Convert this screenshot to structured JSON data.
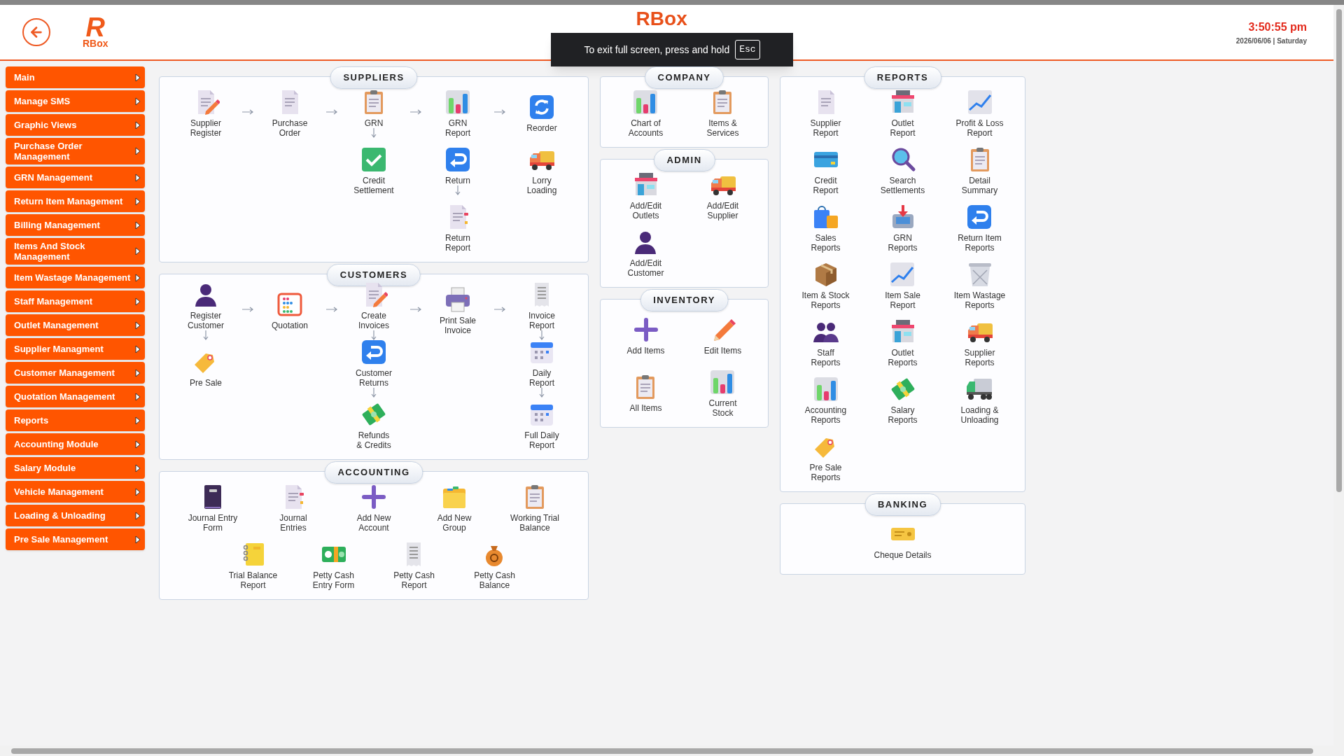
{
  "header": {
    "logo_letter": "R",
    "logo_name": "RBox",
    "title": "RBox",
    "time": "3:50:55 pm",
    "date": "2026/06/06 | Saturday"
  },
  "fullscreen_notice": {
    "text": "To exit full screen, press and hold",
    "key": "Esc"
  },
  "sidebar": {
    "items": [
      {
        "label": "Main"
      },
      {
        "label": "Manage SMS"
      },
      {
        "label": "Graphic Views"
      },
      {
        "label": "Purchase Order Management"
      },
      {
        "label": "GRN Management"
      },
      {
        "label": "Return Item Management"
      },
      {
        "label": "Billing Management"
      },
      {
        "label": "Items And Stock Management"
      },
      {
        "label": "Item Wastage Management"
      },
      {
        "label": "Staff Management"
      },
      {
        "label": "Outlet Management"
      },
      {
        "label": "Supplier Managment"
      },
      {
        "label": "Customer Management"
      },
      {
        "label": "Quotation Management"
      },
      {
        "label": "Reports"
      },
      {
        "label": "Accounting Module"
      },
      {
        "label": "Salary Module"
      },
      {
        "label": "Vehicle Management"
      },
      {
        "label": "Loading & Unloading"
      },
      {
        "label": "Pre Sale Management"
      }
    ]
  },
  "panel_columns": [
    {
      "sections": [
        {
          "title": "SUPPLIERS",
          "kind": "flow",
          "columns": [
            [
              {
                "label": "Supplier\nRegister",
                "flows_down": false
              }
            ],
            [
              {
                "label": "Purchase\nOrder",
                "flows_down": false
              }
            ],
            [
              {
                "label": "GRN",
                "flows_down": true
              },
              {
                "label": "Credit\nSettlement",
                "flows_down": false
              }
            ],
            [
              {
                "label": "GRN\nReport",
                "flows_down": false
              },
              {
                "label": "Return",
                "flows_down": true
              },
              {
                "label": "Return\nReport",
                "flows_down": false
              }
            ],
            [
              {
                "label": "Reorder",
                "flows_down": false
              },
              {
                "label": "Lorry\nLoading",
                "flows_down": false
              }
            ]
          ]
        },
        {
          "title": "CUSTOMERS",
          "kind": "flow",
          "columns": [
            [
              {
                "label": "Register\nCustomer",
                "flows_down": true
              },
              {
                "label": "Pre Sale",
                "flows_down": false
              }
            ],
            [
              {
                "label": "Quotation",
                "flows_down": false
              }
            ],
            [
              {
                "label": "Create\nInvoices",
                "flows_down": true
              },
              {
                "label": "Customer\nReturns",
                "flows_down": true
              },
              {
                "label": "Refunds\n& Credits",
                "flows_down": false
              }
            ],
            [
              {
                "label": "Print Sale\nInvoice",
                "flows_down": false
              }
            ],
            [
              {
                "label": "Invoice\nReport",
                "flows_down": true
              },
              {
                "label": "Daily\nReport",
                "flows_down": true
              },
              {
                "label": "Full Daily\nReport",
                "flows_down": false
              }
            ]
          ]
        },
        {
          "title": "ACCOUNTING",
          "kind": "centered_rows",
          "rows": [
            [
              {
                "label": "Journal Entry\nForm"
              },
              {
                "label": "Journal\nEntries"
              },
              {
                "label": "Add New\nAccount"
              },
              {
                "label": "Add New\nGroup"
              },
              {
                "label": "Working Trial\nBalance"
              }
            ],
            [
              {
                "label": "Trial Balance\nReport"
              },
              {
                "label": "Petty Cash\nEntry Form"
              },
              {
                "label": "Petty Cash\nReport"
              },
              {
                "label": "Petty Cash\nBalance"
              }
            ]
          ]
        }
      ]
    },
    {
      "sections": [
        {
          "title": "COMPANY",
          "kind": "grid",
          "rows": [
            [
              {
                "label": "Chart of\nAccounts"
              },
              {
                "label": "Items &\nServices"
              }
            ]
          ]
        },
        {
          "title": "ADMIN",
          "kind": "grid",
          "rows": [
            [
              {
                "label": "Add/Edit\nOutlets"
              },
              {
                "label": "Add/Edit\nSupplier"
              }
            ],
            [
              {
                "label": "Add/Edit\nCustomer"
              }
            ]
          ]
        },
        {
          "title": "INVENTORY",
          "kind": "grid",
          "rows": [
            [
              {
                "label": "Add Items"
              },
              {
                "label": "Edit Items"
              }
            ],
            [
              {
                "label": "All Items"
              },
              {
                "label": "Current\nStock"
              }
            ]
          ]
        }
      ]
    },
    {
      "sections": [
        {
          "title": "REPORTS",
          "kind": "grid",
          "rows": [
            [
              {
                "label": "Supplier\nReport"
              },
              {
                "label": "Outlet\nReport"
              },
              {
                "label": "Profit & Loss\nReport"
              }
            ],
            [
              {
                "label": "Credit\nReport"
              },
              {
                "label": "Search\nSettlements"
              },
              {
                "label": "Detail\nSummary"
              }
            ],
            [
              {
                "label": "Sales\nReports"
              },
              {
                "label": "GRN\nReports"
              },
              {
                "label": "Return Item\nReports"
              }
            ],
            [
              {
                "label": "Item & Stock\nReports"
              },
              {
                "label": "Item Sale\nReport"
              },
              {
                "label": "Item Wastage\nReports"
              }
            ],
            [
              {
                "label": "Staff\nReports"
              },
              {
                "label": "Outlet\nReports"
              },
              {
                "label": "Supplier\nReports"
              }
            ],
            [
              {
                "label": "Accounting\nReports"
              },
              {
                "label": "Salary\nReports"
              },
              {
                "label": "Loading &\nUnloading"
              }
            ],
            [
              {
                "label": "Pre Sale\nReports"
              }
            ]
          ]
        },
        {
          "title": "BANKING",
          "kind": "grid",
          "rows": [
            [
              {
                "label": "Cheque Details"
              }
            ]
          ]
        }
      ]
    }
  ]
}
